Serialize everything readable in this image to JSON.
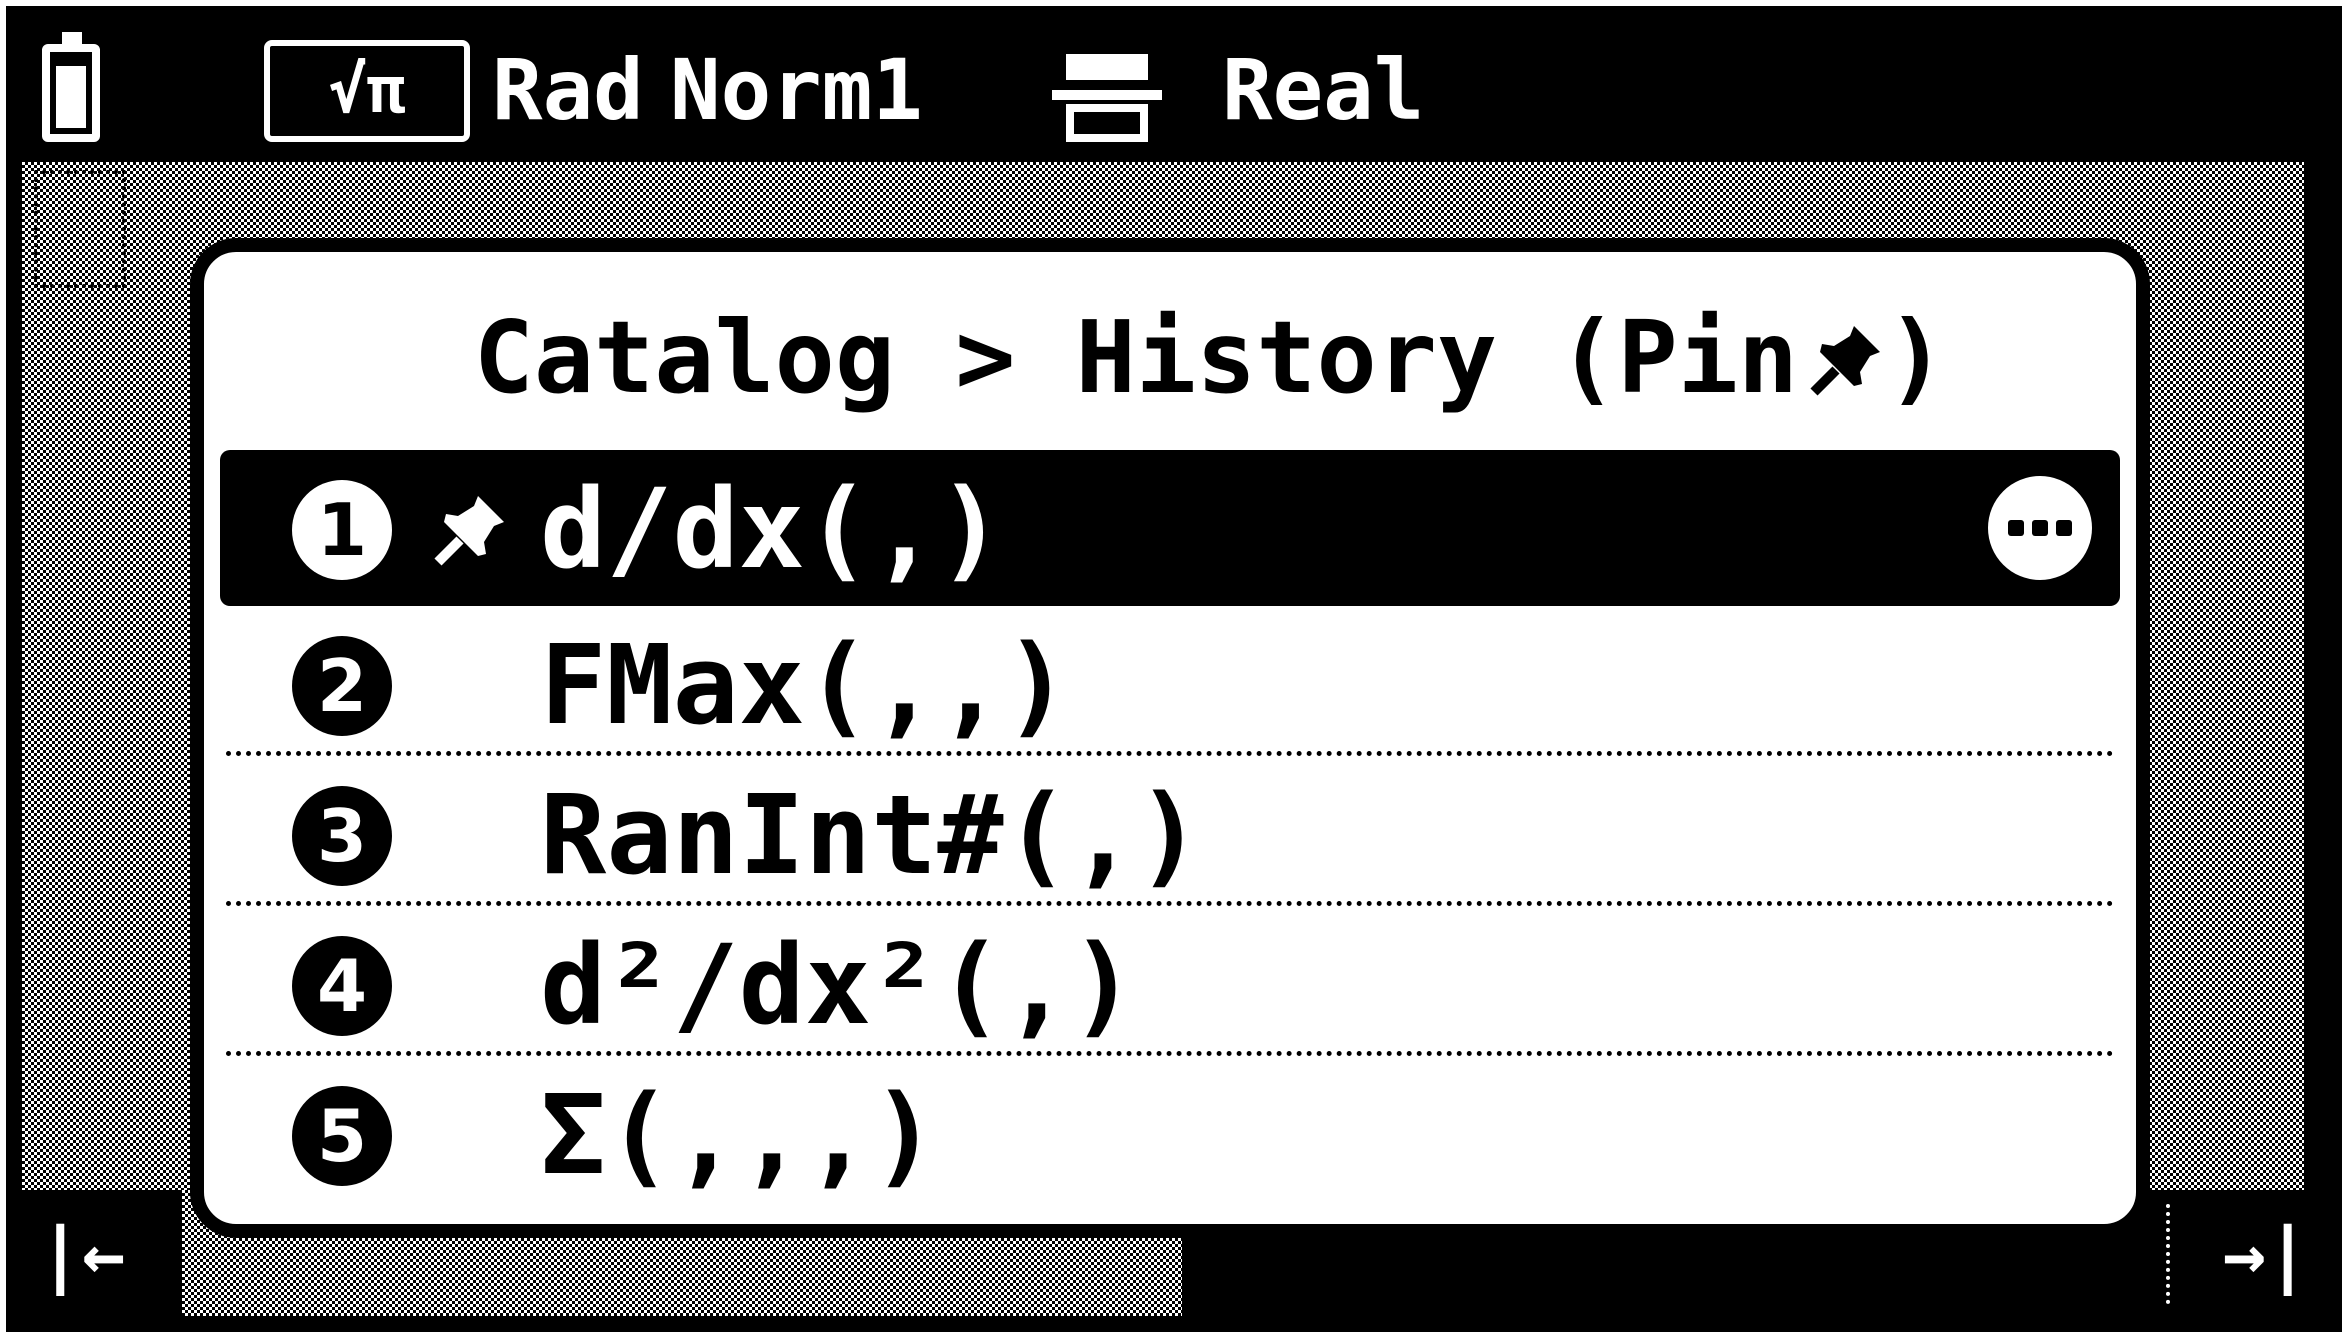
{
  "status_bar": {
    "mode_box": "√π",
    "angle_mode": "Rad",
    "display_mode": "Norm1",
    "complex_mode": "Real",
    "icons": [
      "battery-icon",
      "fraction-display-icon"
    ]
  },
  "popup": {
    "title": "Catalog > History (Pin",
    "title_icon": "pin-icon",
    "items": [
      {
        "number": "1",
        "pinned": true,
        "text": "d/dx(,)",
        "selected": true
      },
      {
        "number": "2",
        "pinned": false,
        "text": "FMax(,,)",
        "selected": false
      },
      {
        "number": "3",
        "pinned": false,
        "text": "RanInt#(,)",
        "selected": false
      },
      {
        "number": "4",
        "pinned": false,
        "text": "d²/dx²(,)",
        "selected": false
      },
      {
        "number": "5",
        "pinned": false,
        "text": "Σ(,,,)",
        "selected": false
      }
    ]
  },
  "bottom_bar": {
    "left_arrow": "|←",
    "right_arrow": "→|"
  },
  "colors": {
    "foreground": "#000000",
    "background": "#ffffff"
  }
}
